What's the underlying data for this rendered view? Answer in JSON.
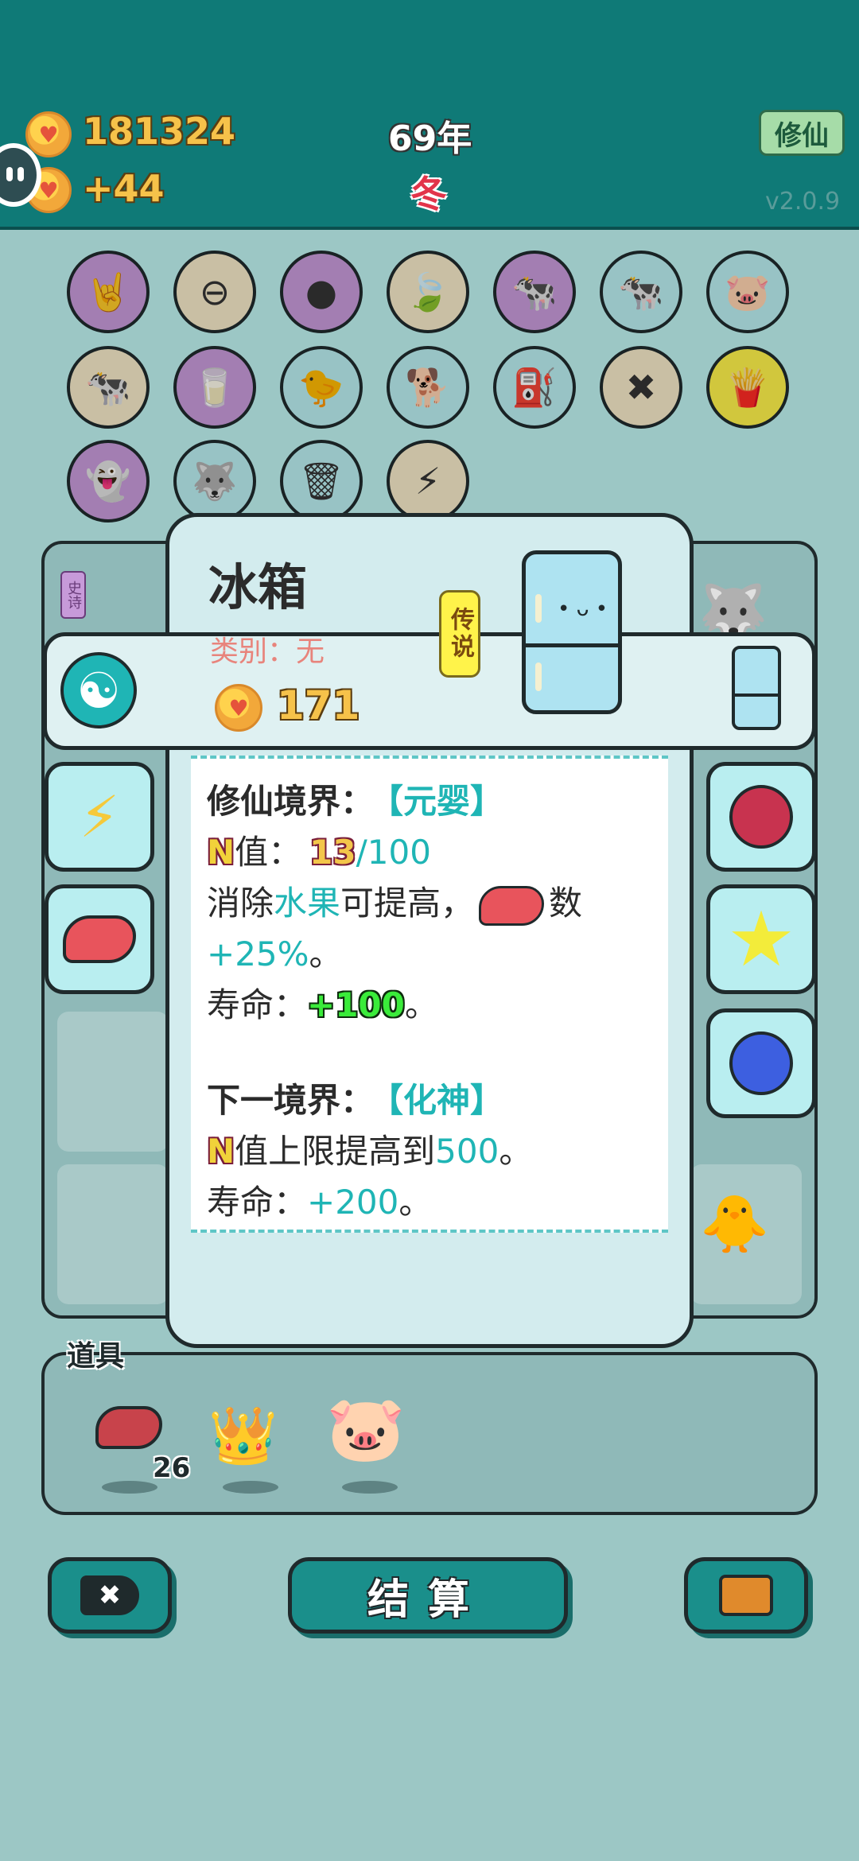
{
  "header": {
    "coins": "181324",
    "income": "+44",
    "year": "69年",
    "season": "冬",
    "cultivate_button": "修仙",
    "version": "v2.0.9"
  },
  "board_icons": [
    "rock-hand-icon",
    "no-entry-icon",
    "eyepatch-icon",
    "leaf-icon",
    "cow-pair-icon",
    "cow-pair-icon",
    "piggy-bank-icon",
    "cow-pair-icon",
    "milk-jar-icon",
    "chick-egg-icon",
    "cool-dog-icon",
    "pump-icon",
    "delete-tag-icon",
    "fries-icon",
    "traffic-ghost-icon",
    "husky-icon",
    "trash-bag-icon",
    "lightning-icon"
  ],
  "popup": {
    "item_name": "冰箱",
    "category": "类别：无",
    "rarity_tag": "传说",
    "price": "171",
    "realm_label": "修仙境界：",
    "realm_value": "【元婴】",
    "n_letter": "N",
    "n_value_label": "值：",
    "n_current": "13",
    "n_max": "/100",
    "eliminate_prefix": "消除",
    "eliminate_fruit": "水果",
    "eliminate_suffix": "可提高，",
    "count_suffix": "数",
    "percent_bonus": "+25%",
    "period": "。",
    "life_label": "寿命：",
    "life_value": "+100",
    "next_realm_label": "下一境界：",
    "next_realm_value": "【化神】",
    "next_n_text": "值上限提高到",
    "next_n_value": "500",
    "next_life_value": "+200"
  },
  "side_left_tag": "史诗",
  "props": {
    "label": "道具",
    "items": [
      {
        "icon": "liver-icon",
        "count": "26"
      },
      {
        "icon": "crown-icon",
        "count": ""
      },
      {
        "icon": "piggy-bank-icon",
        "count": ""
      }
    ]
  },
  "footer": {
    "settle_label": "结算"
  }
}
